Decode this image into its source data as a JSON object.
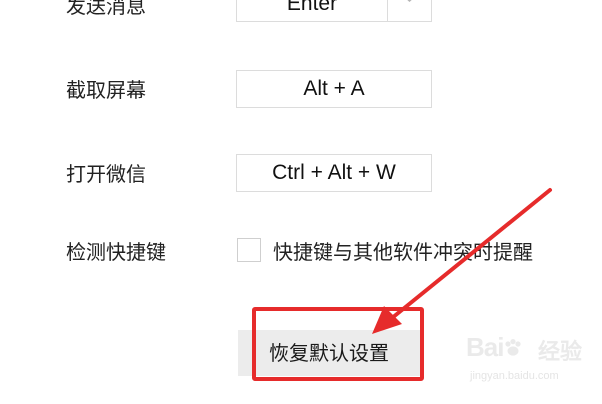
{
  "settings": {
    "send_message": {
      "label": "发送消息",
      "value": "Enter"
    },
    "screenshot": {
      "label": "截取屏幕",
      "value": "Alt + A"
    },
    "open_wechat": {
      "label": "打开微信",
      "value": "Ctrl + Alt + W"
    },
    "detect_shortcuts": {
      "label": "检测快捷键",
      "checkbox_label": "快捷键与其他软件冲突时提醒",
      "checked": false
    },
    "restore_button_label": "恢复默认设置"
  },
  "annotation": {
    "color": "#e62b2b"
  },
  "watermark": {
    "brand": "Bai",
    "brand_cn": "经验",
    "url": "jingyan.baidu.com"
  }
}
